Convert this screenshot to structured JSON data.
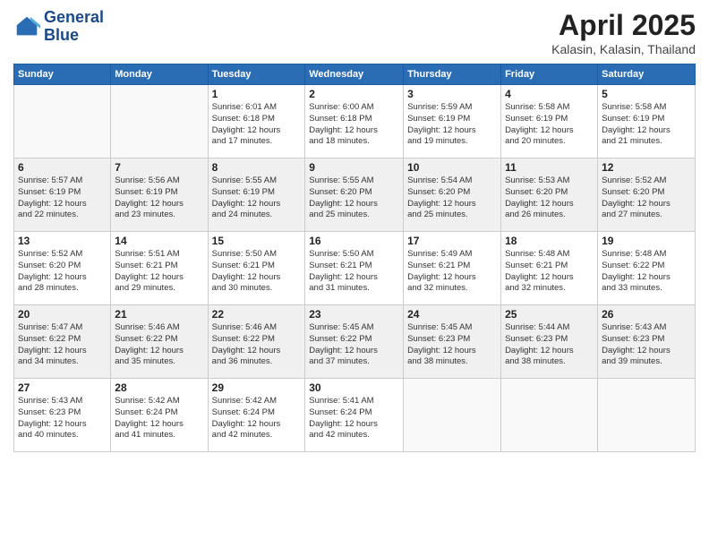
{
  "header": {
    "logo_line1": "General",
    "logo_line2": "Blue",
    "month": "April 2025",
    "location": "Kalasin, Kalasin, Thailand"
  },
  "days_of_week": [
    "Sunday",
    "Monday",
    "Tuesday",
    "Wednesday",
    "Thursday",
    "Friday",
    "Saturday"
  ],
  "weeks": [
    [
      {
        "num": "",
        "info": ""
      },
      {
        "num": "",
        "info": ""
      },
      {
        "num": "1",
        "info": "Sunrise: 6:01 AM\nSunset: 6:18 PM\nDaylight: 12 hours\nand 17 minutes."
      },
      {
        "num": "2",
        "info": "Sunrise: 6:00 AM\nSunset: 6:18 PM\nDaylight: 12 hours\nand 18 minutes."
      },
      {
        "num": "3",
        "info": "Sunrise: 5:59 AM\nSunset: 6:19 PM\nDaylight: 12 hours\nand 19 minutes."
      },
      {
        "num": "4",
        "info": "Sunrise: 5:58 AM\nSunset: 6:19 PM\nDaylight: 12 hours\nand 20 minutes."
      },
      {
        "num": "5",
        "info": "Sunrise: 5:58 AM\nSunset: 6:19 PM\nDaylight: 12 hours\nand 21 minutes."
      }
    ],
    [
      {
        "num": "6",
        "info": "Sunrise: 5:57 AM\nSunset: 6:19 PM\nDaylight: 12 hours\nand 22 minutes."
      },
      {
        "num": "7",
        "info": "Sunrise: 5:56 AM\nSunset: 6:19 PM\nDaylight: 12 hours\nand 23 minutes."
      },
      {
        "num": "8",
        "info": "Sunrise: 5:55 AM\nSunset: 6:19 PM\nDaylight: 12 hours\nand 24 minutes."
      },
      {
        "num": "9",
        "info": "Sunrise: 5:55 AM\nSunset: 6:20 PM\nDaylight: 12 hours\nand 25 minutes."
      },
      {
        "num": "10",
        "info": "Sunrise: 5:54 AM\nSunset: 6:20 PM\nDaylight: 12 hours\nand 25 minutes."
      },
      {
        "num": "11",
        "info": "Sunrise: 5:53 AM\nSunset: 6:20 PM\nDaylight: 12 hours\nand 26 minutes."
      },
      {
        "num": "12",
        "info": "Sunrise: 5:52 AM\nSunset: 6:20 PM\nDaylight: 12 hours\nand 27 minutes."
      }
    ],
    [
      {
        "num": "13",
        "info": "Sunrise: 5:52 AM\nSunset: 6:20 PM\nDaylight: 12 hours\nand 28 minutes."
      },
      {
        "num": "14",
        "info": "Sunrise: 5:51 AM\nSunset: 6:21 PM\nDaylight: 12 hours\nand 29 minutes."
      },
      {
        "num": "15",
        "info": "Sunrise: 5:50 AM\nSunset: 6:21 PM\nDaylight: 12 hours\nand 30 minutes."
      },
      {
        "num": "16",
        "info": "Sunrise: 5:50 AM\nSunset: 6:21 PM\nDaylight: 12 hours\nand 31 minutes."
      },
      {
        "num": "17",
        "info": "Sunrise: 5:49 AM\nSunset: 6:21 PM\nDaylight: 12 hours\nand 32 minutes."
      },
      {
        "num": "18",
        "info": "Sunrise: 5:48 AM\nSunset: 6:21 PM\nDaylight: 12 hours\nand 32 minutes."
      },
      {
        "num": "19",
        "info": "Sunrise: 5:48 AM\nSunset: 6:22 PM\nDaylight: 12 hours\nand 33 minutes."
      }
    ],
    [
      {
        "num": "20",
        "info": "Sunrise: 5:47 AM\nSunset: 6:22 PM\nDaylight: 12 hours\nand 34 minutes."
      },
      {
        "num": "21",
        "info": "Sunrise: 5:46 AM\nSunset: 6:22 PM\nDaylight: 12 hours\nand 35 minutes."
      },
      {
        "num": "22",
        "info": "Sunrise: 5:46 AM\nSunset: 6:22 PM\nDaylight: 12 hours\nand 36 minutes."
      },
      {
        "num": "23",
        "info": "Sunrise: 5:45 AM\nSunset: 6:22 PM\nDaylight: 12 hours\nand 37 minutes."
      },
      {
        "num": "24",
        "info": "Sunrise: 5:45 AM\nSunset: 6:23 PM\nDaylight: 12 hours\nand 38 minutes."
      },
      {
        "num": "25",
        "info": "Sunrise: 5:44 AM\nSunset: 6:23 PM\nDaylight: 12 hours\nand 38 minutes."
      },
      {
        "num": "26",
        "info": "Sunrise: 5:43 AM\nSunset: 6:23 PM\nDaylight: 12 hours\nand 39 minutes."
      }
    ],
    [
      {
        "num": "27",
        "info": "Sunrise: 5:43 AM\nSunset: 6:23 PM\nDaylight: 12 hours\nand 40 minutes."
      },
      {
        "num": "28",
        "info": "Sunrise: 5:42 AM\nSunset: 6:24 PM\nDaylight: 12 hours\nand 41 minutes."
      },
      {
        "num": "29",
        "info": "Sunrise: 5:42 AM\nSunset: 6:24 PM\nDaylight: 12 hours\nand 42 minutes."
      },
      {
        "num": "30",
        "info": "Sunrise: 5:41 AM\nSunset: 6:24 PM\nDaylight: 12 hours\nand 42 minutes."
      },
      {
        "num": "",
        "info": ""
      },
      {
        "num": "",
        "info": ""
      },
      {
        "num": "",
        "info": ""
      }
    ]
  ]
}
